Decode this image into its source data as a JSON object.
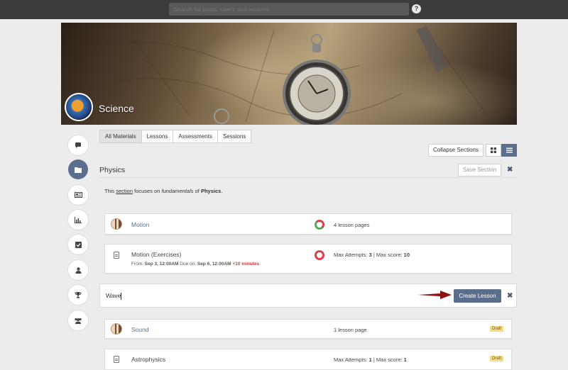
{
  "header": {
    "search_placeholder": "Search for posts, users and lessons",
    "help_icon": "question-circle-icon"
  },
  "course": {
    "title": "Science"
  },
  "sidebar": {
    "items": [
      {
        "icon": "comment-icon"
      },
      {
        "icon": "folder-icon",
        "active": true
      },
      {
        "icon": "newspaper-icon"
      },
      {
        "icon": "bar-chart-icon"
      },
      {
        "icon": "checkbox-icon"
      },
      {
        "icon": "user-icon"
      },
      {
        "icon": "trophy-icon"
      },
      {
        "icon": "users-icon"
      }
    ]
  },
  "tabs": [
    "All Materials",
    "Lessons",
    "Assessments",
    "Sessions"
  ],
  "toolbar": {
    "collapse_label": "Collapse Sections",
    "grid_icon": "grid-icon",
    "list_icon": "list-icon"
  },
  "section": {
    "title": "Physics",
    "save_label": "Save Section",
    "description": {
      "prefix": "This ",
      "link": "section",
      "mid": " focuses on ",
      "italic": "fundamentals",
      "of": " of ",
      "bold": "Physics",
      "end": "."
    }
  },
  "items": [
    {
      "name": "Motion",
      "meta_text": "4 lesson pages"
    },
    {
      "name": "Motion (Exercises)",
      "attempts_label": "Max Attempts: ",
      "attempts": "3",
      "sep": " | Max score: ",
      "score": "10",
      "from_label": "From: ",
      "from": "Sep 3, 12:00AM",
      "due_label": "  Due on: ",
      "due": "Sep 6, 12:00AM",
      "late": "+10 minutes"
    },
    {
      "name": "Sound",
      "meta_text": "1 lesson page",
      "badge": "Draft"
    },
    {
      "name": "Astrophysics",
      "attempts_label": "Max Attempts: ",
      "attempts": "1",
      "sep": " | Max score: ",
      "score": "1",
      "badge": "Draft"
    }
  ],
  "new_lesson": {
    "value": "Wave",
    "create_label": "Create Lesson"
  },
  "colors": {
    "accent": "#5b6f8c",
    "topbar": "#3b3b3b",
    "arrow": "#8b1010",
    "draft": "#f5dc8a"
  }
}
